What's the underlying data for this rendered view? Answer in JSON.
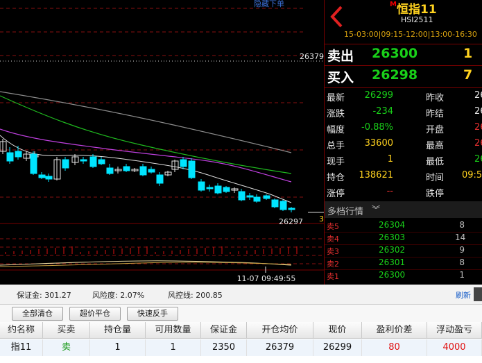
{
  "chart": {
    "hide_order_label": "隐藏下单",
    "avg_cost_label": "26379",
    "last_price_label": "26297",
    "side_price_stub": "3",
    "cursor_time": "11-07 09:49:55",
    "colors": {
      "up": "#e8e8e8",
      "down": "#00e5ff",
      "ma_gray": "#8c8c8c",
      "ma_green": "#1fb91f",
      "ma_magenta": "#c040e0",
      "ma_white": "#e0e0e0",
      "grid_red": "#8a1010",
      "volume": "#e01010"
    }
  },
  "quote": {
    "flag": "M",
    "name": "恒指11",
    "code": "HSI2511",
    "sessions": "15-03:00|09:15-12:00|13:00-16:30",
    "ask": {
      "label": "卖出",
      "price": "26300",
      "volume": "1"
    },
    "bid": {
      "label": "买入",
      "price": "26298",
      "volume": "7"
    },
    "stats": [
      {
        "l1": "最新",
        "v1": "26299",
        "l2": "昨收",
        "v2": "26"
      },
      {
        "l1": "涨跌",
        "v1": "-234",
        "l2": "昨结",
        "v2": "26"
      },
      {
        "l1": "幅度",
        "v1": "-0.88%",
        "l2": "开盘",
        "v2": "26"
      },
      {
        "l1": "总手",
        "v1": "33600",
        "l2": "最高",
        "v2": "26"
      },
      {
        "l1": "现手",
        "v1": "1",
        "l2": "最低",
        "v2": "26"
      },
      {
        "l1": "持仓",
        "v1": "138621",
        "l2": "时间",
        "v2": "09:5"
      },
      {
        "l1": "涨停",
        "v1": "--",
        "l2": "跌停",
        "v2": ""
      }
    ],
    "depth_title": "多档行情",
    "depth_icon": "double-chevron-down-icon",
    "depth": [
      {
        "label": "卖5",
        "price": "26304",
        "volume": "8"
      },
      {
        "label": "卖4",
        "price": "26303",
        "volume": "14"
      },
      {
        "label": "卖3",
        "price": "26302",
        "volume": "9"
      },
      {
        "label": "卖2",
        "price": "26301",
        "volume": "8"
      },
      {
        "label": "卖1",
        "price": "26300",
        "volume": "1"
      }
    ]
  },
  "account": {
    "margin": "保证金: 301.27",
    "risk": "风险度: 2.07%",
    "risk_line": "风控线: 200.85",
    "refresh": "刷新"
  },
  "buttons": {
    "close_all": "全部清仓",
    "super_close": "超价平仓",
    "quick_reverse": "快速反手"
  },
  "positions": {
    "headers": [
      "约名称",
      "买卖",
      "持仓量",
      "可用数量",
      "保证金",
      "开仓均价",
      "现价",
      "盈利价差",
      "浮动盈亏"
    ],
    "rows": [
      [
        "指11",
        "卖",
        "1",
        "1",
        "2350",
        "26379",
        "26299",
        "80",
        "4000"
      ]
    ]
  }
}
